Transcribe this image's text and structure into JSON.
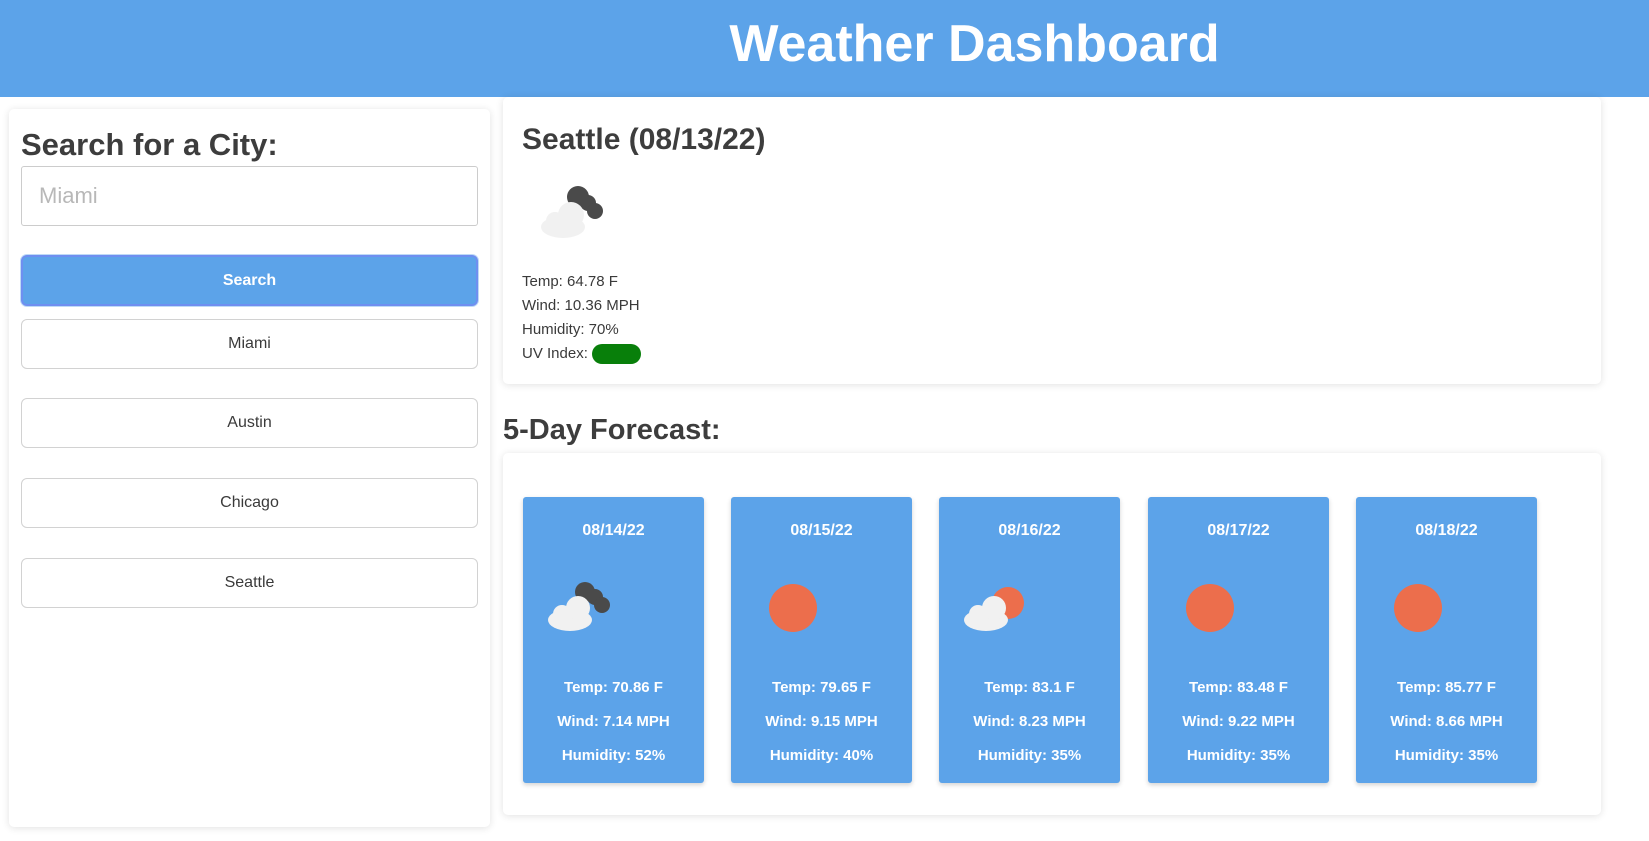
{
  "header": {
    "title": "Weather Dashboard"
  },
  "search": {
    "title": "Search for a City:",
    "placeholder": "Miami",
    "button_label": "Search",
    "history": [
      "Miami",
      "Austin",
      "Chicago",
      "Seattle"
    ]
  },
  "current": {
    "title": "Seattle (08/13/22)",
    "icon": "cloud-icon",
    "temp": "Temp: 64.78 F",
    "wind": "Wind: 10.36 MPH",
    "humidity": "Humidity: 70%",
    "uv_label": "UV Index:",
    "uv_color": "#087f0a"
  },
  "forecast": {
    "heading": "5-Day Forecast:",
    "days": [
      {
        "date": "08/14/22",
        "icon": "cloud-icon",
        "temp": "Temp: 70.86 F",
        "wind": "Wind: 7.14 MPH",
        "humidity": "Humidity: 52%"
      },
      {
        "date": "08/15/22",
        "icon": "sun-icon",
        "temp": "Temp: 79.65 F",
        "wind": "Wind: 9.15 MPH",
        "humidity": "Humidity: 40%"
      },
      {
        "date": "08/16/22",
        "icon": "partly-cloudy-icon",
        "temp": "Temp: 83.1 F",
        "wind": "Wind: 8.23 MPH",
        "humidity": "Humidity: 35%"
      },
      {
        "date": "08/17/22",
        "icon": "sun-icon",
        "temp": "Temp: 83.48 F",
        "wind": "Wind: 9.22 MPH",
        "humidity": "Humidity: 35%"
      },
      {
        "date": "08/18/22",
        "icon": "sun-icon",
        "temp": "Temp: 85.77 F",
        "wind": "Wind: 8.66 MPH",
        "humidity": "Humidity: 35%"
      }
    ]
  },
  "colors": {
    "accent": "#5ca3e9",
    "sun": "#ec6e4c",
    "cloud": "#f1f1f1",
    "dark_cloud": "#4a4a4a"
  }
}
